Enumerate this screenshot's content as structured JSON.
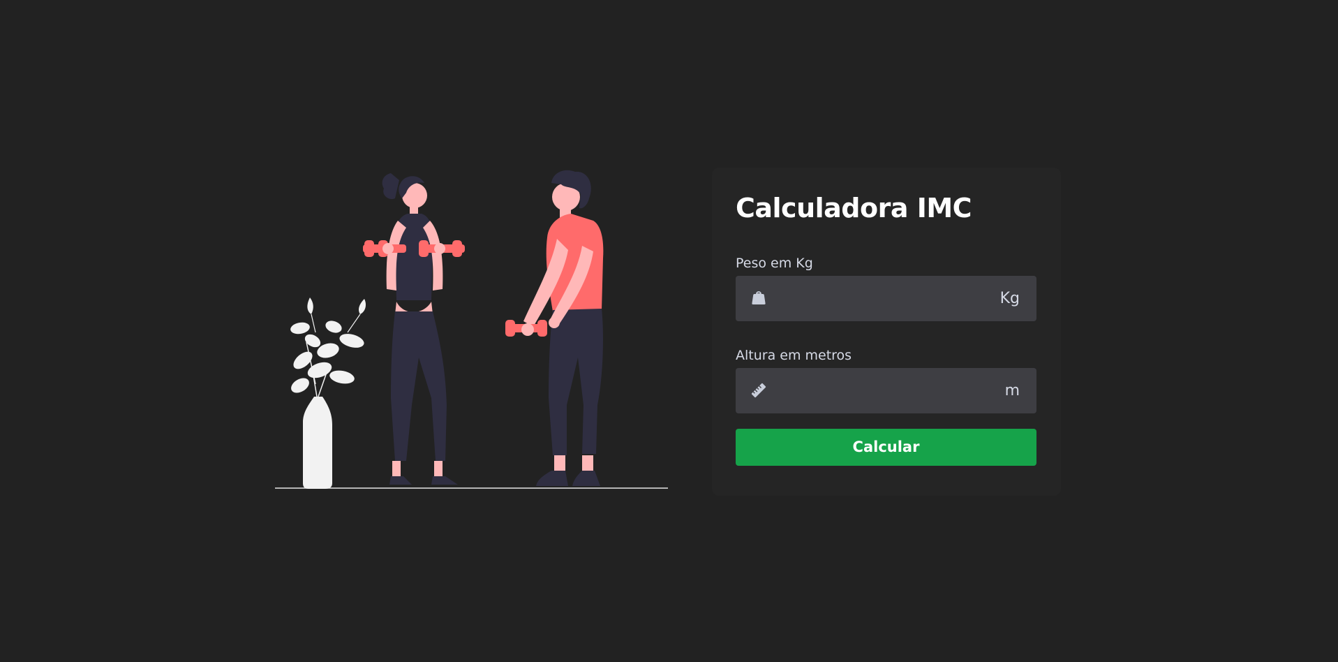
{
  "card": {
    "title": "Calculadora IMC",
    "weight": {
      "label": "Peso em Kg",
      "value": "",
      "placeholder": "",
      "unit": "Kg",
      "icon": "weight-icon"
    },
    "height": {
      "label": "Altura em metros",
      "value": "",
      "placeholder": "",
      "unit": "m",
      "icon": "ruler-icon"
    },
    "button_label": "Calcular"
  },
  "colors": {
    "background": "#222222",
    "card": "#252525",
    "input": "#3e3e43",
    "button": "#16a34a",
    "accent_coral": "#ff6b6b",
    "figure_dark": "#2f2e41",
    "skin": "#ffb8b8",
    "plant": "#f2f2f2"
  }
}
